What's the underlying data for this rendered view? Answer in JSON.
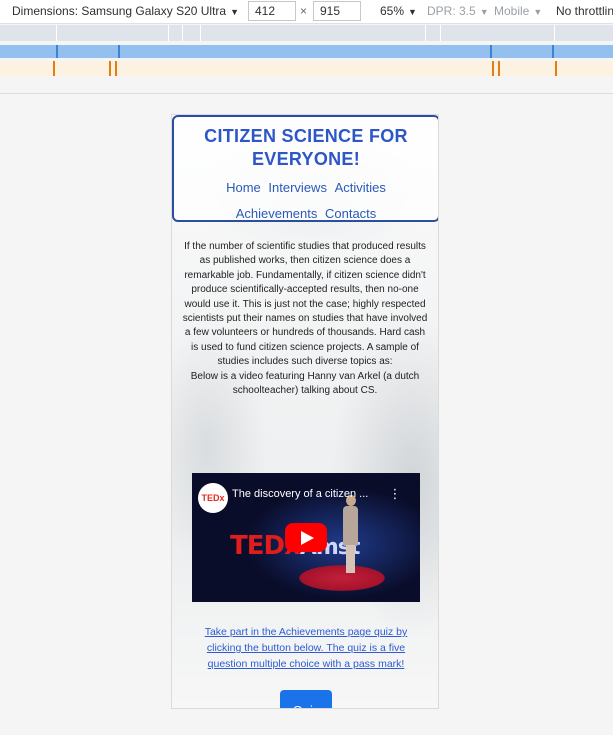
{
  "devtools": {
    "device_label": "Dimensions: Samsung Galaxy S20 Ultra",
    "width": "412",
    "times": "×",
    "height": "915",
    "zoom": "65%",
    "dpr": "DPR: 3.5",
    "mode": "Mobile",
    "throttle": "No throttlin",
    "caret": "▼"
  },
  "site": {
    "title": "CITIZEN SCIENCE FOR EVERYONE!",
    "nav": [
      "Home",
      "Interviews",
      "Activities",
      "Achievements",
      "Contacts"
    ]
  },
  "intro": {
    "paragraph": "If the number of scientific studies that produced results as published works, then citizen science does a remarkable job. Fundamentally, if citizen science didn't produce scientifically-accepted results, then no-one would use it. This is just not the case; highly respected scientists put their names on studies that have involved a few volunteers or hundreds of thousands. Hard cash is used to fund citizen science projects. A sample of studies includes such diverse topics as:",
    "video_note": "Below is a video featuring Hanny van Arkel (a dutch schoolteacher) talking about CS."
  },
  "video": {
    "title": "The discovery of a citizen ...",
    "channel_logo": "TEDx",
    "menu_glyph": "⋮",
    "stage_text": "TEDx",
    "stage_text_suffix": "Amst"
  },
  "quiz": {
    "link_text": "Take part in the Achievements page quiz by clicking the button below. The quiz is a five question multiple choice with a pass mark!",
    "button_label": "Quiz"
  },
  "colors": {
    "title": "#2d57c7",
    "nav": "#2b59b8",
    "header_border": "#2b4f9e",
    "quiz_button": "#1a73e8",
    "youtube_red": "#ff0000"
  }
}
